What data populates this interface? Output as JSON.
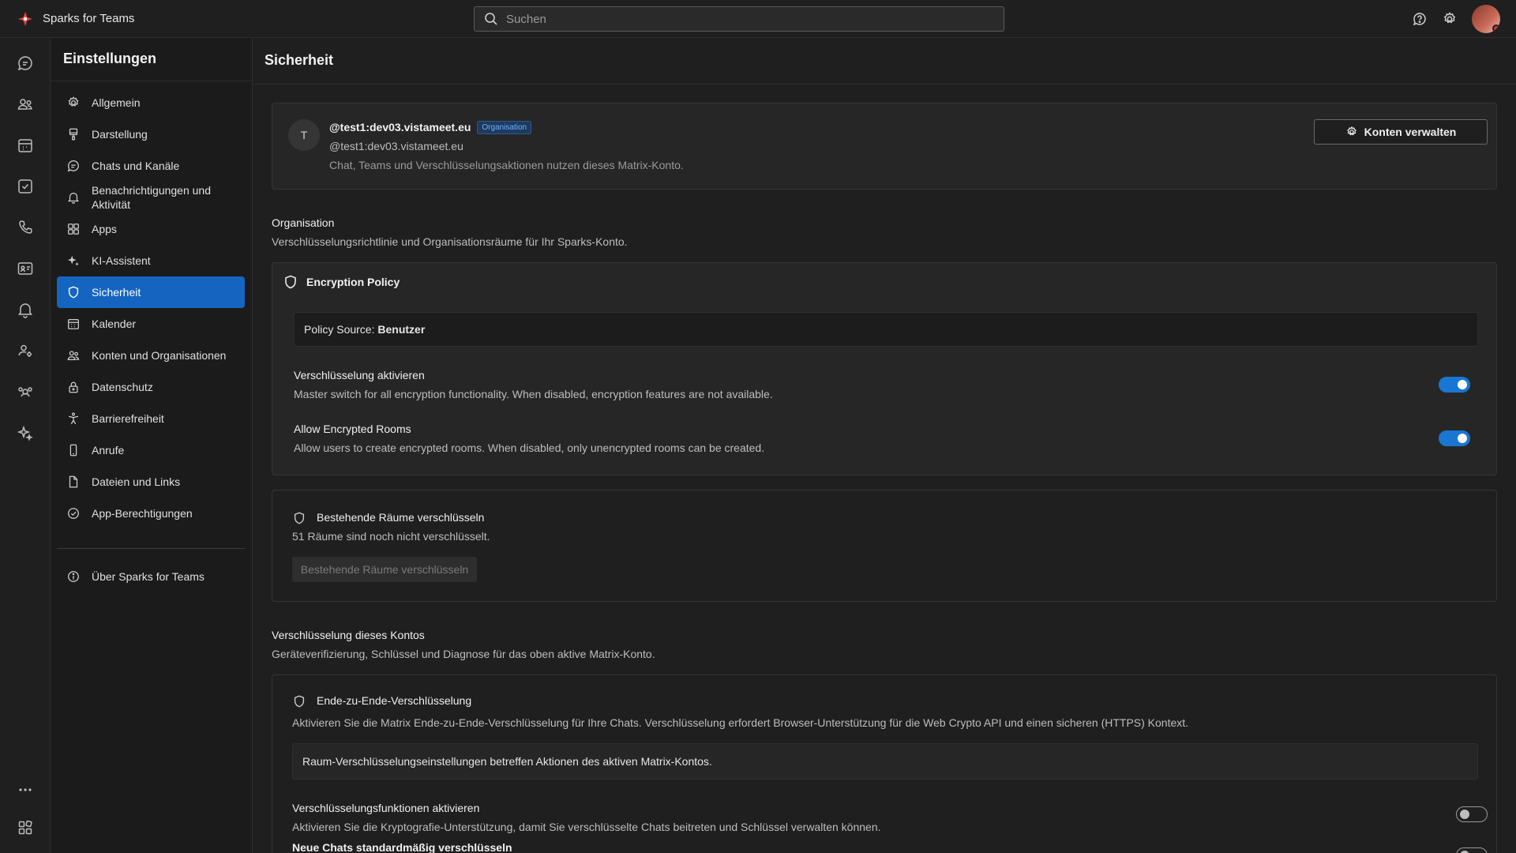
{
  "app": {
    "title": "Sparks for Teams"
  },
  "search": {
    "placeholder": "Suchen"
  },
  "settings": {
    "title": "Einstellungen",
    "items": [
      {
        "label": "Allgemein",
        "icon": "gear-icon"
      },
      {
        "label": "Darstellung",
        "icon": "brush-icon"
      },
      {
        "label": "Chats und Kanäle",
        "icon": "chat-icon"
      },
      {
        "label": "Benachrichtigungen und Aktivität",
        "icon": "bell-icon"
      },
      {
        "label": "Apps",
        "icon": "apps-icon"
      },
      {
        "label": "KI-Assistent",
        "icon": "sparkle-icon"
      },
      {
        "label": "Sicherheit",
        "icon": "shield-icon",
        "active": true
      },
      {
        "label": "Kalender",
        "icon": "calendar-icon"
      },
      {
        "label": "Konten und Organisationen",
        "icon": "people-icon"
      },
      {
        "label": "Datenschutz",
        "icon": "lock-icon"
      },
      {
        "label": "Barrierefreiheit",
        "icon": "accessibility-icon"
      },
      {
        "label": "Anrufe",
        "icon": "phone-icon"
      },
      {
        "label": "Dateien und Links",
        "icon": "file-icon"
      },
      {
        "label": "App-Berechtigungen",
        "icon": "check-circle-icon"
      }
    ],
    "about": {
      "label": "Über Sparks for Teams",
      "icon": "info-icon"
    }
  },
  "page": {
    "title": "Sicherheit"
  },
  "account": {
    "initial": "T",
    "id": "@test1:dev03.vistameet.eu",
    "badge": "Organisation",
    "server": "@test1:dev03.vistameet.eu",
    "description": "Chat, Teams und Verschlüsselungsaktionen nutzen dieses Matrix-Konto.",
    "manage_button": "Konten verwalten"
  },
  "organisation": {
    "heading": "Organisation",
    "description": "Verschlüsselungsrichtlinie und Organisationsräume für Ihr Sparks-Konto.",
    "policy": {
      "title": "Encryption Policy",
      "source_label": "Policy Source:",
      "source_value": "Benutzer",
      "settings": [
        {
          "title": "Verschlüsselung aktivieren",
          "description": "Master switch for all encryption functionality. When disabled, encryption features are not available.",
          "enabled": true
        },
        {
          "title": "Allow Encrypted Rooms",
          "description": "Allow users to create encrypted rooms. When disabled, only unencrypted rooms can be created.",
          "enabled": true
        }
      ]
    },
    "existing_rooms": {
      "title": "Bestehende Räume verschlüsseln",
      "status": "51 Räume sind noch nicht verschlüsselt.",
      "button": "Bestehende Räume verschlüsseln"
    }
  },
  "account_encryption": {
    "heading": "Verschlüsselung dieses Kontos",
    "description": "Geräteverifizierung, Schlüssel und Diagnose für das oben aktive Matrix-Konto.",
    "e2e": {
      "title": "Ende-zu-Ende-Verschlüsselung",
      "description": "Aktivieren Sie die Matrix Ende-zu-Ende-Verschlüsselung für Ihre Chats. Verschlüsselung erfordert Browser-Unterstützung für die Web Crypto API und einen sicheren (HTTPS) Kontext.",
      "info": "Raum-Verschlüsselungseinstellungen betreffen Aktionen des aktiven Matrix-Kontos.",
      "settings": [
        {
          "title": "Verschlüsselungsfunktionen aktivieren",
          "description": "Aktivieren Sie die Kryptografie-Unterstützung, damit Sie verschlüsselte Chats beitreten und Schlüssel verwalten können.",
          "enabled": false
        },
        {
          "title": "Neue Chats standardmäßig verschlüsseln",
          "enabled": false
        }
      ]
    }
  },
  "colors": {
    "accent": "#1976d2",
    "active_nav": "#1565c0",
    "background": "#1f1f1f"
  }
}
